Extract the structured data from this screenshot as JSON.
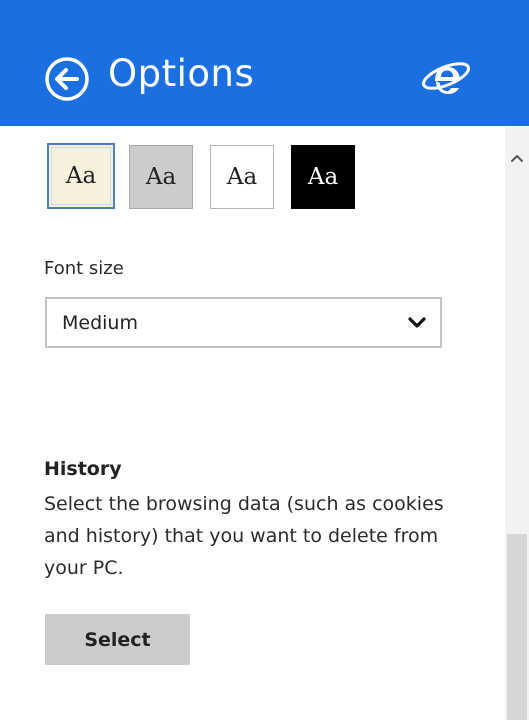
{
  "header": {
    "title": "Options",
    "back_icon": "circle-back-arrow-icon",
    "app_icon": "internet-explorer-logo",
    "background_color": "#1c6fe0"
  },
  "reading_view": {
    "swatches": [
      {
        "label": "Aa",
        "style": "sepia",
        "selected": true
      },
      {
        "label": "Aa",
        "style": "medium-gray",
        "selected": false
      },
      {
        "label": "Aa",
        "style": "light",
        "selected": false
      },
      {
        "label": "Aa",
        "style": "dark",
        "selected": false
      }
    ],
    "font_size_label": "Font size",
    "font_size_value": "Medium"
  },
  "history": {
    "title": "History",
    "description": "Select the browsing data (such as cookies and history) that you want to delete from your PC.",
    "button_label": "Select"
  }
}
